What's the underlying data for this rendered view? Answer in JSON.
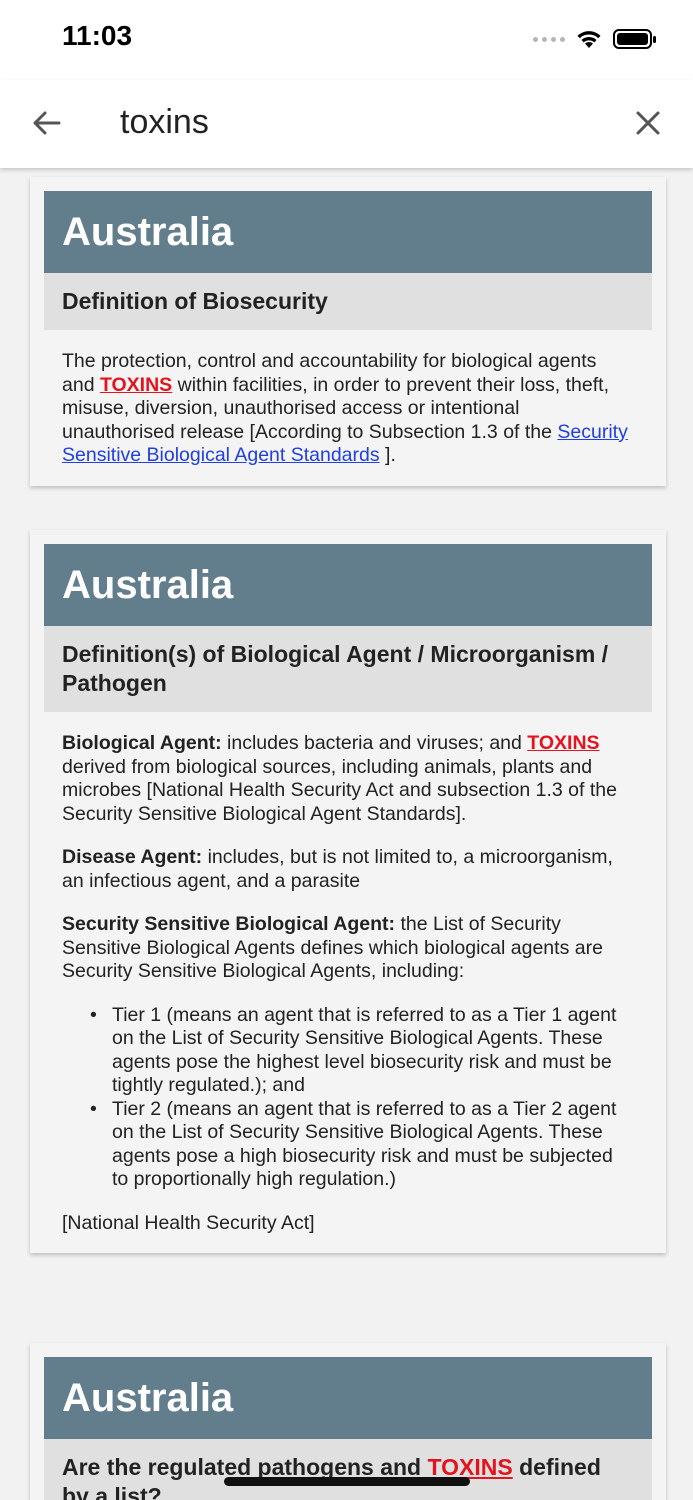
{
  "status_bar": {
    "time": "11:03"
  },
  "search": {
    "query": "toxins"
  },
  "results": [
    {
      "country": "Australia",
      "section": "Definition of Biosecurity",
      "body": {
        "t1": "The protection, control and accountability for biological agents and ",
        "hl1": "TOXINS",
        "t2": " within facilities, in order to prevent their loss, theft, misuse, diversion, unauthorised access or intentional unauthorised release [According to Subsection 1.3 of the ",
        "link": "Security Sensitive Biological Agent Standards",
        "t3": " ]."
      }
    },
    {
      "country": "Australia",
      "section": "Definition(s) of Biological Agent / Microorganism / Pathogen",
      "body": {
        "p1_term": "Biological Agent:",
        "p1_t1": " includes bacteria and viruses; and ",
        "p1_hl": "TOXINS",
        "p1_t2": " derived from biological sources, including animals, plants and microbes [National Health Security Act and subsection 1.3 of the Security Sensitive Biological Agent Standards].",
        "p2_term": "Disease Agent:",
        "p2_text": " includes, but is not limited to, a microorganism, an infectious agent, and a parasite",
        "p3_term": "Security Sensitive Biological Agent:",
        "p3_text": " the List of Security Sensitive Biological Agents defines which biological agents are Security Sensitive Biological Agents, including:",
        "bullets": [
          "Tier 1 (means an agent that is referred to as a Tier 1 agent on the List of Security Sensitive Biological Agents. These agents pose the highest level biosecurity risk and must be tightly regulated.); and",
          "Tier 2 (means an agent that is referred to as a Tier 2 agent on the List of Security Sensitive Biological Agents. These agents pose a high biosecurity risk and must be subjected to proportionally high regulation.)"
        ],
        "source": "[National Health Security Act]"
      }
    },
    {
      "country": "Australia",
      "section_t1": "Are the regulated pathogens and ",
      "section_hl": "TOXINS",
      "section_t2": " defined by a list?"
    }
  ],
  "colors": {
    "country_header": "#627d8b",
    "section_header": "#e0e0e0",
    "highlight": "#e3141e",
    "link": "#1f3fe0"
  },
  "icons": {
    "back": "arrow-left-icon",
    "clear": "close-icon",
    "wifi": "wifi-icon",
    "battery": "battery-icon",
    "signal": "signal-icon"
  }
}
